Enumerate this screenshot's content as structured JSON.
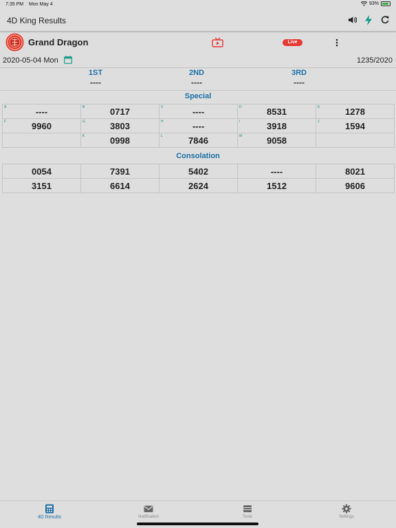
{
  "status": {
    "time": "7:35 PM",
    "date": "Mon May 4",
    "battery": "93%",
    "battery_level": 0.93
  },
  "appbar": {
    "title": "4D King Results"
  },
  "operator": {
    "name": "Grand Dragon",
    "live": "Live"
  },
  "draw": {
    "date": "2020-05-04 Mon",
    "number": "1235/2020"
  },
  "top_prizes": [
    {
      "label": "1ST",
      "value": "----"
    },
    {
      "label": "2ND",
      "value": "----"
    },
    {
      "label": "3RD",
      "value": "----"
    }
  ],
  "special": {
    "title": "Special",
    "cells": [
      {
        "letter": "A",
        "value": "----"
      },
      {
        "letter": "B",
        "value": "0717"
      },
      {
        "letter": "C",
        "value": "----"
      },
      {
        "letter": "D",
        "value": "8531"
      },
      {
        "letter": "E",
        "value": "1278"
      },
      {
        "letter": "F",
        "value": "9960"
      },
      {
        "letter": "G",
        "value": "3803"
      },
      {
        "letter": "H",
        "value": "----"
      },
      {
        "letter": "I",
        "value": "3918"
      },
      {
        "letter": "J",
        "value": "1594"
      },
      {
        "letter": "",
        "value": ""
      },
      {
        "letter": "K",
        "value": "0998"
      },
      {
        "letter": "L",
        "value": "7846"
      },
      {
        "letter": "M",
        "value": "9058"
      },
      {
        "letter": "",
        "value": ""
      }
    ]
  },
  "consolation": {
    "title": "Consolation",
    "cells": [
      "0054",
      "7391",
      "5402",
      "----",
      "8021",
      "3151",
      "6614",
      "2624",
      "1512",
      "9606"
    ]
  },
  "tabs": [
    {
      "label": "4D Results",
      "icon": "calculator-icon",
      "active": true
    },
    {
      "label": "Notification",
      "icon": "envelope-icon",
      "active": false
    },
    {
      "label": "Tools",
      "icon": "tools-icon",
      "active": false
    },
    {
      "label": "Settings",
      "icon": "gear-icon",
      "active": false
    }
  ],
  "colors": {
    "accent": "#1a6fa6",
    "live": "#e53935",
    "teal": "#1a8a8a",
    "logo": "#e53935"
  }
}
